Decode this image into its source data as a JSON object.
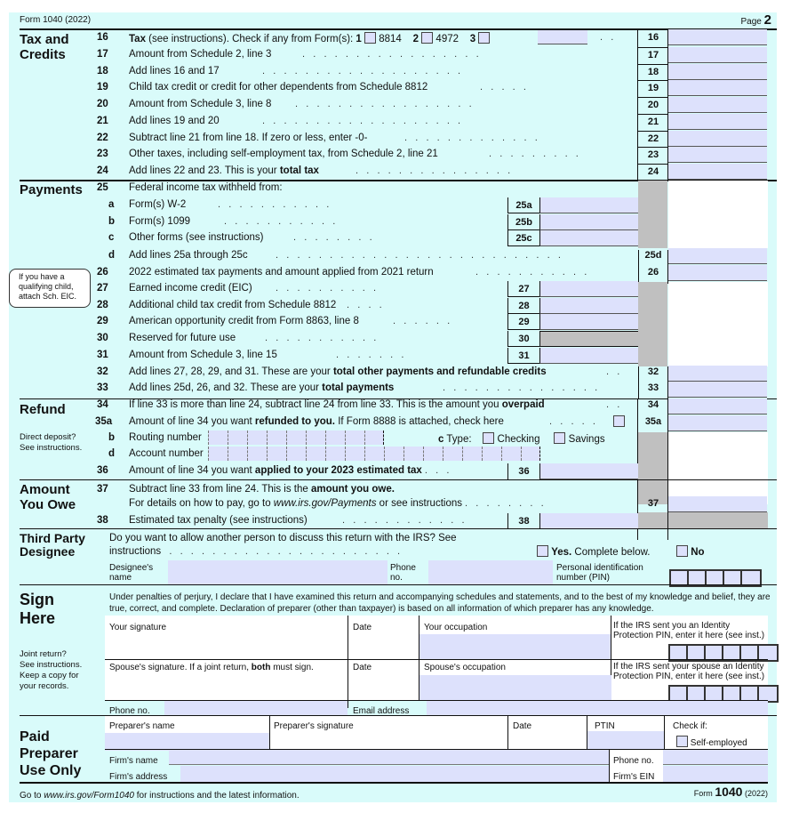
{
  "header": {
    "form_label": "Form 1040 (2022)",
    "page_label": "Page",
    "page_number": "2"
  },
  "sections": {
    "tax_credits": "Tax and\nCredits",
    "payments": "Payments",
    "refund": "Refund",
    "amount_owe": "Amount\nYou Owe",
    "third_party": "Third Party\nDesignee",
    "sign_here": "Sign\nHere",
    "paid_preparer": "Paid\nPreparer\nUse Only"
  },
  "line16": {
    "num": "16",
    "bold": "Tax",
    "text": " (see instructions). Check if any from Form(s): ",
    "opt1_num": "1",
    "opt1": "8814",
    "opt2_num": "2",
    "opt2": "4972",
    "opt3_num": "3"
  },
  "lines": [
    {
      "num": "17",
      "text": "Amount from Schedule 2, line 3"
    },
    {
      "num": "18",
      "text": "Add lines 16 and 17"
    },
    {
      "num": "19",
      "text": "Child tax credit or credit for other dependents from Schedule 8812"
    },
    {
      "num": "20",
      "text": "Amount from Schedule 3, line 8"
    },
    {
      "num": "21",
      "text": "Add lines 19 and 20"
    },
    {
      "num": "22",
      "text": "Subtract line 21 from line 18. If zero or less, enter -0-"
    },
    {
      "num": "23",
      "text": "Other taxes, including self-employment tax, from Schedule 2, line 21"
    },
    {
      "num": "24",
      "text": "Add lines 22 and 23. This is your ",
      "bold": "total tax"
    }
  ],
  "payments": {
    "line25": {
      "num": "25",
      "text": "Federal income tax withheld from:"
    },
    "sub": [
      {
        "letter": "a",
        "text": "Form(s) W-2",
        "box": "25a"
      },
      {
        "letter": "b",
        "text": "Form(s) 1099",
        "box": "25b"
      },
      {
        "letter": "c",
        "text": "Other forms (see instructions)",
        "box": "25c"
      }
    ],
    "line25d": {
      "letter": "d",
      "text": "Add lines 25a through 25c",
      "box": "25d"
    },
    "line26": {
      "num": "26",
      "text": "2022 estimated tax payments and amount applied from 2021 return",
      "box": "26"
    },
    "credits": [
      {
        "num": "27",
        "text": "Earned income credit (EIC)"
      },
      {
        "num": "28",
        "text": "Additional child tax credit from Schedule 8812"
      },
      {
        "num": "29",
        "text": "American opportunity credit from Form 8863, line 8"
      },
      {
        "num": "30",
        "text": "Reserved for future use"
      },
      {
        "num": "31",
        "text": "Amount from Schedule 3, line 15"
      }
    ],
    "line32": {
      "num": "32",
      "text": "Add lines 27, 28, 29, and 31. These are your ",
      "bold": "total other payments and refundable credits"
    },
    "line33": {
      "num": "33",
      "text": "Add lines 25d, 26, and 32. These are your ",
      "bold": "total payments"
    },
    "eic_note": "If you have a qualifying child, attach Sch. EIC."
  },
  "refund": {
    "line34": {
      "num": "34",
      "text": "If line 33 is more than line 24, subtract line 24 from line 33. This is the amount you ",
      "bold": "overpaid"
    },
    "line35a": {
      "num": "35a",
      "text1": "Amount of line 34 you want ",
      "bold": "refunded to you.",
      "text2": " If Form 8888 is attached, check here"
    },
    "routing": {
      "letter": "b",
      "label": "Routing number",
      "type_letter": "c",
      "type_label": "Type:",
      "checking": "Checking",
      "savings": "Savings"
    },
    "account": {
      "letter": "d",
      "label": "Account number"
    },
    "line36": {
      "num": "36",
      "text1": "Amount of line 34 you want ",
      "bold": "applied to your 2023 estimated tax"
    },
    "note": "Direct deposit?\nSee instructions."
  },
  "owe": {
    "line37": {
      "num": "37",
      "text1": "Subtract line 33 from line 24. This is the ",
      "bold": "amount you owe.",
      "text2a": "For details on how to pay, go to ",
      "link": "www.irs.gov/Payments",
      "text2b": " or see instructions"
    },
    "line38": {
      "num": "38",
      "text": "Estimated tax penalty (see instructions)"
    }
  },
  "designee": {
    "question": "Do you want to allow another person to discuss this return with the IRS? See",
    "question2": "instructions",
    "yes_bold": "Yes.",
    "yes_rest": " Complete below.",
    "no": "No",
    "name_label": "Designee's\nname",
    "phone_label": "Phone\nno.",
    "pin_label": "Personal identification\nnumber (PIN)"
  },
  "sign": {
    "declaration": "Under penalties of perjury, I declare that I have examined this return and accompanying schedules and statements, and to the best of my knowledge and belief, they are true, correct, and complete. Declaration of preparer (other than taxpayer) is based on all information of which preparer has any knowledge.",
    "your_sig": "Your signature",
    "date": "Date",
    "your_occ": "Your occupation",
    "ip_pin": "If the IRS sent you an Identity Protection PIN, enter it here (see inst.)",
    "spouse_sig1": "Spouse's signature. If a joint return, ",
    "spouse_bold": "both",
    "spouse_sig2": " must sign.",
    "spouse_occ": "Spouse's occupation",
    "spouse_pin": "If the IRS sent your spouse an Identity Protection PIN, enter it here (see inst.)",
    "phone": "Phone no.",
    "email": "Email address",
    "note": "Joint return?\nSee instructions.\nKeep a copy for\nyour records."
  },
  "preparer": {
    "name": "Preparer's name",
    "signature": "Preparer's signature",
    "date": "Date",
    "ptin": "PTIN",
    "check_if": "Check if:",
    "self_employed": "Self-employed",
    "firm_name": "Firm's name",
    "firm_address": "Firm's address",
    "phone": "Phone no.",
    "ein": "Firm's EIN"
  },
  "footer": {
    "pre": "Go to ",
    "link": "www.irs.gov/Form1040",
    "post": " for instructions and the latest information.",
    "form": "Form",
    "form_num": "1040",
    "year": "(2022)"
  }
}
